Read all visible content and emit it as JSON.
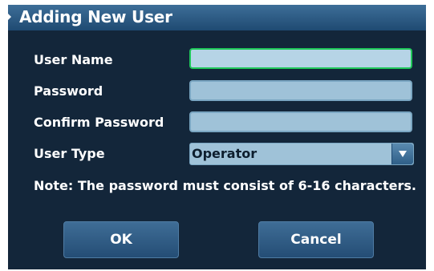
{
  "dialog": {
    "title": "Adding New User"
  },
  "form": {
    "user_name": {
      "label": "User Name",
      "value": ""
    },
    "password": {
      "label": "Password",
      "value": ""
    },
    "confirm_password": {
      "label": "Confirm Password",
      "value": ""
    },
    "user_type": {
      "label": "User Type",
      "selected": "Operator"
    }
  },
  "note": "Note: The password must consist of 6-16 characters.",
  "buttons": {
    "ok": "OK",
    "cancel": "Cancel"
  },
  "colors": {
    "panel_bg": "#13263a",
    "title_bg": "#2b5a85",
    "field_bg": "#9fc2d8",
    "focus_border": "#1fc85a",
    "button_bg": "#2f5f88"
  },
  "icons": {
    "dropdown": "chevron-down-icon"
  }
}
